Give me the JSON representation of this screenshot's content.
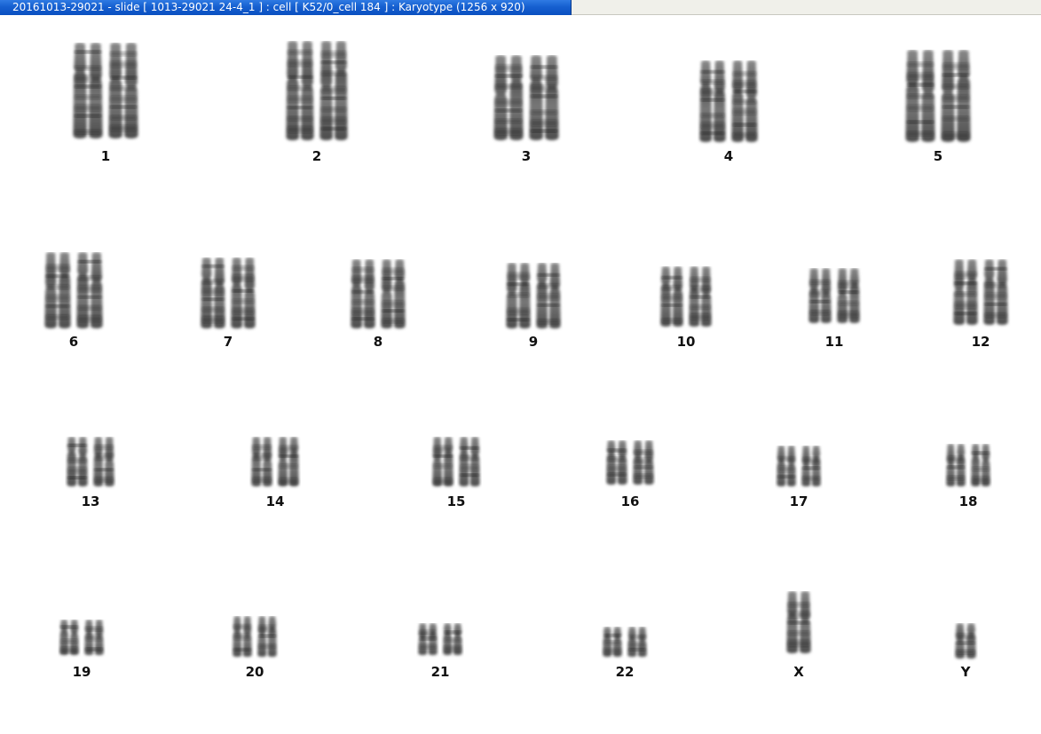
{
  "window": {
    "title": "20161013-29021 - slide [ 1013-29021 24-4_1 ] : cell [ K52/0_cell 184 ] : Karyotype  (1256 x 920)"
  },
  "karyotype": {
    "chromosomes": [
      {
        "label": "1"
      },
      {
        "label": "2"
      },
      {
        "label": "3"
      },
      {
        "label": "4"
      },
      {
        "label": "5"
      },
      {
        "label": "6"
      },
      {
        "label": "7"
      },
      {
        "label": "8"
      },
      {
        "label": "9"
      },
      {
        "label": "10"
      },
      {
        "label": "11"
      },
      {
        "label": "12"
      },
      {
        "label": "13"
      },
      {
        "label": "14"
      },
      {
        "label": "15"
      },
      {
        "label": "16"
      },
      {
        "label": "17"
      },
      {
        "label": "18"
      },
      {
        "label": "19"
      },
      {
        "label": "20"
      },
      {
        "label": "21"
      },
      {
        "label": "22"
      },
      {
        "label": "X"
      },
      {
        "label": "Y"
      }
    ]
  }
}
